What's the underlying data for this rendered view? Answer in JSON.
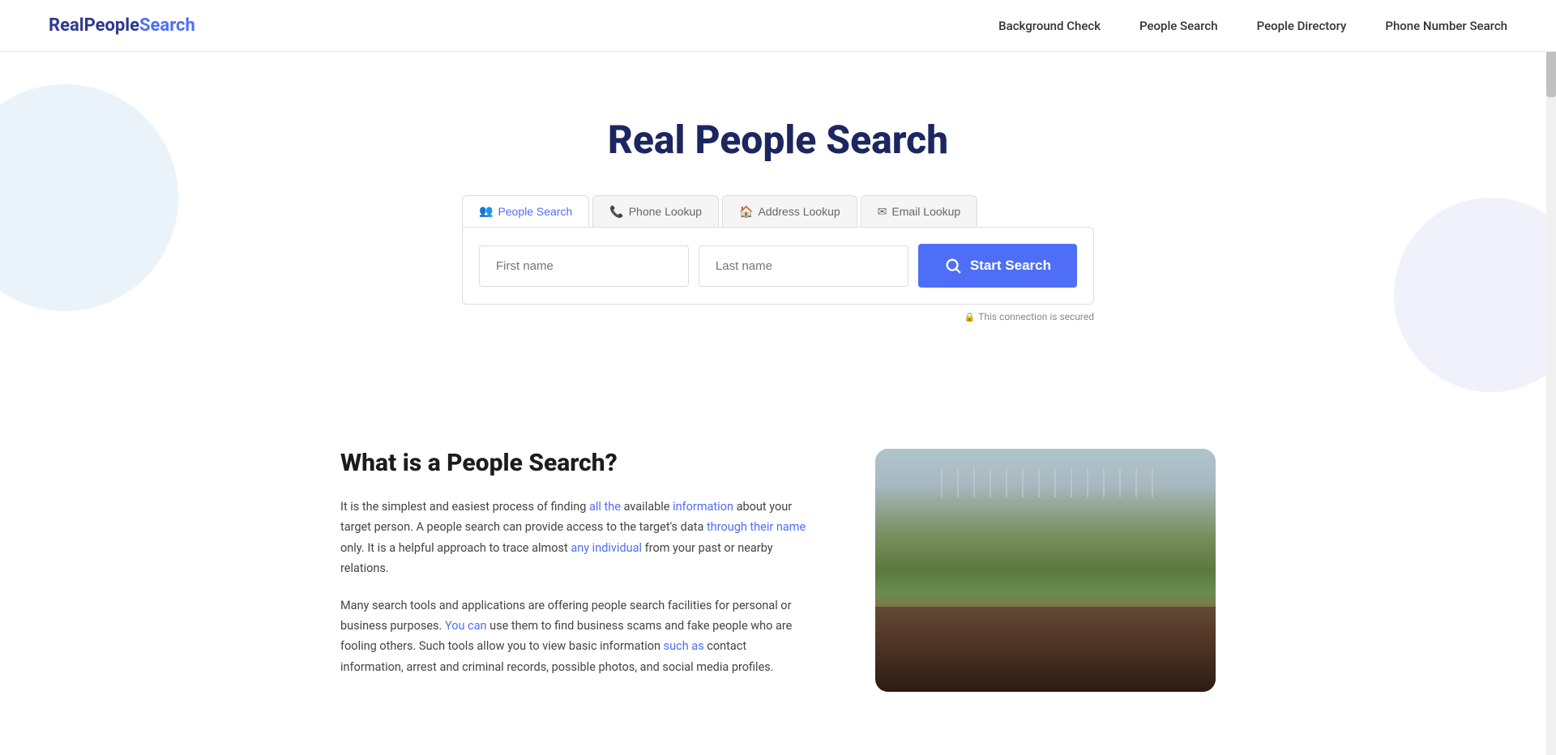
{
  "site": {
    "logo_real": "Real",
    "logo_people": "People",
    "logo_search": "Search"
  },
  "nav": {
    "links": [
      {
        "id": "background-check",
        "label": "Background Check",
        "href": "#"
      },
      {
        "id": "people-search",
        "label": "People Search",
        "href": "#"
      },
      {
        "id": "people-directory",
        "label": "People Directory",
        "href": "#"
      },
      {
        "id": "phone-number-search",
        "label": "Phone Number Search",
        "href": "#"
      }
    ]
  },
  "hero": {
    "title": "Real People Search"
  },
  "search": {
    "tabs": [
      {
        "id": "people-search",
        "label": "People Search",
        "icon": "👥",
        "active": true
      },
      {
        "id": "phone-lookup",
        "label": "Phone Lookup",
        "icon": "📞",
        "active": false
      },
      {
        "id": "address-lookup",
        "label": "Address Lookup",
        "icon": "🏠",
        "active": false
      },
      {
        "id": "email-lookup",
        "label": "Email Lookup",
        "icon": "✉",
        "active": false
      }
    ],
    "first_name_placeholder": "First name",
    "last_name_placeholder": "Last name",
    "search_button_label": "Start Search",
    "secured_text": "This connection is secured"
  },
  "content": {
    "section_title": "What is a People Search?",
    "paragraph1": "It is the simplest and easiest process of finding all the available information about your target person. A people search can provide access to the target's data through their name only. It is a helpful approach to trace almost any individual from your past or nearby relations.",
    "paragraph2": "Many search tools and applications are offering people search facilities for personal or business purposes. You can use them to find business scams and fake people who are fooling others. Such tools allow you to view basic information such as contact information, arrest and criminal records, possible photos, and social media profiles."
  }
}
